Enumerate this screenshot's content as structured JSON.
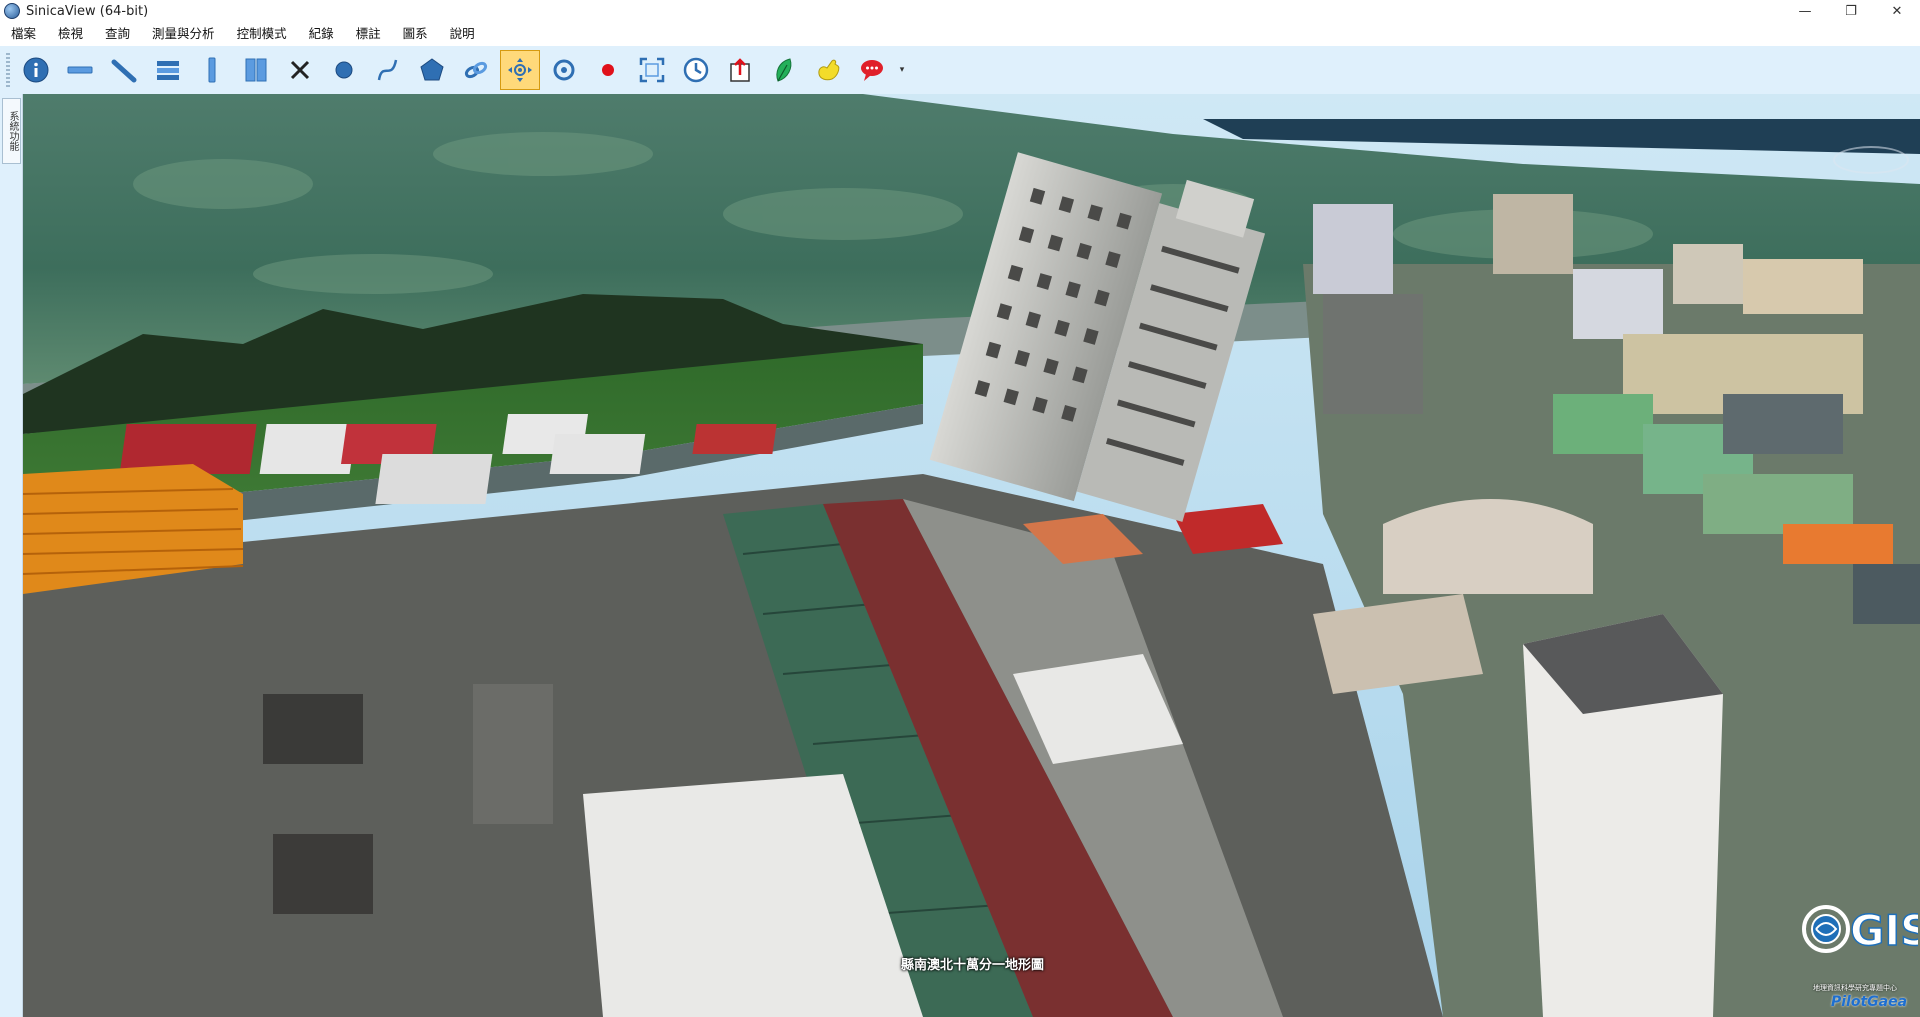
{
  "window": {
    "title": "SinicaView (64-bit)",
    "controls": [
      "—",
      "❐",
      "✕"
    ]
  },
  "menu": {
    "items": [
      "檔案",
      "檢視",
      "查詢",
      "測量與分析",
      "控制模式",
      "紀錄",
      "標註",
      "圖系",
      "說明"
    ]
  },
  "toolbar": {
    "tools": [
      {
        "icon": "info-icon",
        "active": false
      },
      {
        "icon": "horizontal-line-icon",
        "active": false
      },
      {
        "icon": "diagonal-line-icon",
        "active": false
      },
      {
        "icon": "stacked-bars-icon",
        "active": false
      },
      {
        "icon": "vertical-bar-icon",
        "active": false
      },
      {
        "icon": "book-icon",
        "active": false
      },
      {
        "icon": "clear-x-icon",
        "active": false
      },
      {
        "icon": "circle-icon",
        "active": false
      },
      {
        "icon": "curve-icon",
        "active": false
      },
      {
        "icon": "polygon-icon",
        "active": false
      },
      {
        "icon": "link-icon",
        "active": false
      },
      {
        "icon": "pan-navigate-icon",
        "active": true
      },
      {
        "icon": "rotate-icon",
        "active": false
      },
      {
        "icon": "record-icon",
        "active": false
      },
      {
        "icon": "fullscreen-icon",
        "active": false
      },
      {
        "icon": "history-clock-icon",
        "active": false
      },
      {
        "icon": "export-icon",
        "active": false
      },
      {
        "icon": "leaf-icon",
        "active": false
      },
      {
        "icon": "hand-icon",
        "active": false
      },
      {
        "icon": "comment-icon",
        "active": false
      }
    ],
    "dropdown": "▾"
  },
  "side_panel": {
    "tab_label": "系統功能"
  },
  "viewport": {
    "caption": "縣南澳北十萬分一地形圖",
    "logo_text": "GIS",
    "logo_subtext": "地理資訊科學研究專題中心",
    "vendor_text": "PilotGaea"
  },
  "colors": {
    "toolbar_bg": "#dff0fc",
    "active_tool": "#ffd97a",
    "icon_blue": "#2f6fb3"
  }
}
